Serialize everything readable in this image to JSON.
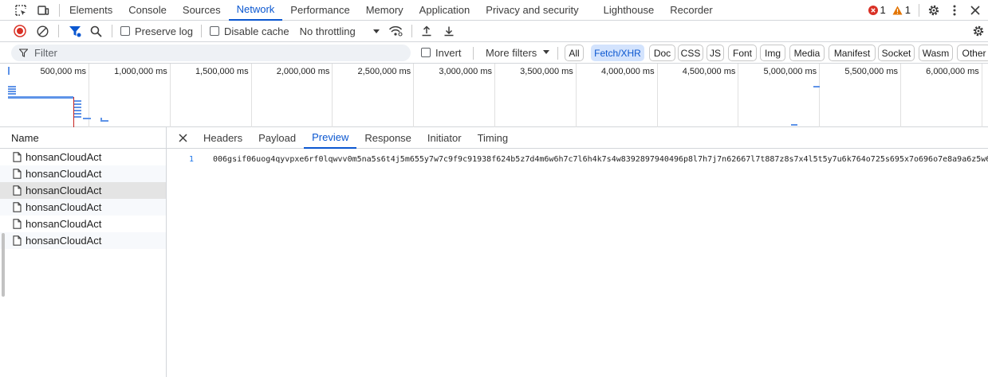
{
  "tabs": [
    "Elements",
    "Console",
    "Sources",
    "Network",
    "Performance",
    "Memory",
    "Application",
    "Privacy and security",
    "Lighthouse",
    "Recorder"
  ],
  "active_tab": "Network",
  "status": {
    "errors": "1",
    "warnings": "1"
  },
  "toolbar": {
    "preserve_log": "Preserve log",
    "disable_cache": "Disable cache",
    "throttling": "No throttling"
  },
  "filter": {
    "placeholder": "Filter",
    "invert": "Invert",
    "more_filters": "More filters",
    "chips": [
      "All",
      "Fetch/XHR",
      "Doc",
      "CSS",
      "JS",
      "Font",
      "Img",
      "Media",
      "Manifest",
      "Socket",
      "Wasm",
      "Other"
    ],
    "active_chip": "Fetch/XHR"
  },
  "overview": {
    "ticks": [
      "500,000 ms",
      "1,000,000 ms",
      "1,500,000 ms",
      "2,000,000 ms",
      "2,500,000 ms",
      "3,000,000 ms",
      "3,500,000 ms",
      "4,000,000 ms",
      "4,500,000 ms",
      "5,000,000 ms",
      "5,500,000 ms",
      "6,000,000 ms"
    ]
  },
  "requests": {
    "header": "Name",
    "items": [
      "honsanCloudAct",
      "honsanCloudAct",
      "honsanCloudAct",
      "honsanCloudAct",
      "honsanCloudAct",
      "honsanCloudAct"
    ],
    "selected_index": 2
  },
  "detail": {
    "tabs": [
      "Headers",
      "Payload",
      "Preview",
      "Response",
      "Initiator",
      "Timing"
    ],
    "active_tab": "Preview"
  },
  "preview": {
    "line_number": "1",
    "text": "006gsif06uog4qyvpxe6rf0lqwvv0m5na5s6t4j5m655y7w7c9f9c91938f624b5z7d4m6w6h7c7l6h4k7s4w8392897940496p8l7h7j7n62667l7t887z8s7x4l5t5y7u6k764o725s695x7o696o7e8a9a6z5w6"
  },
  "colors": {
    "accent": "#0b57d0",
    "error": "#d93025",
    "warning": "#e37400",
    "bar": "#5e93e8",
    "marker": "#c5221f"
  }
}
